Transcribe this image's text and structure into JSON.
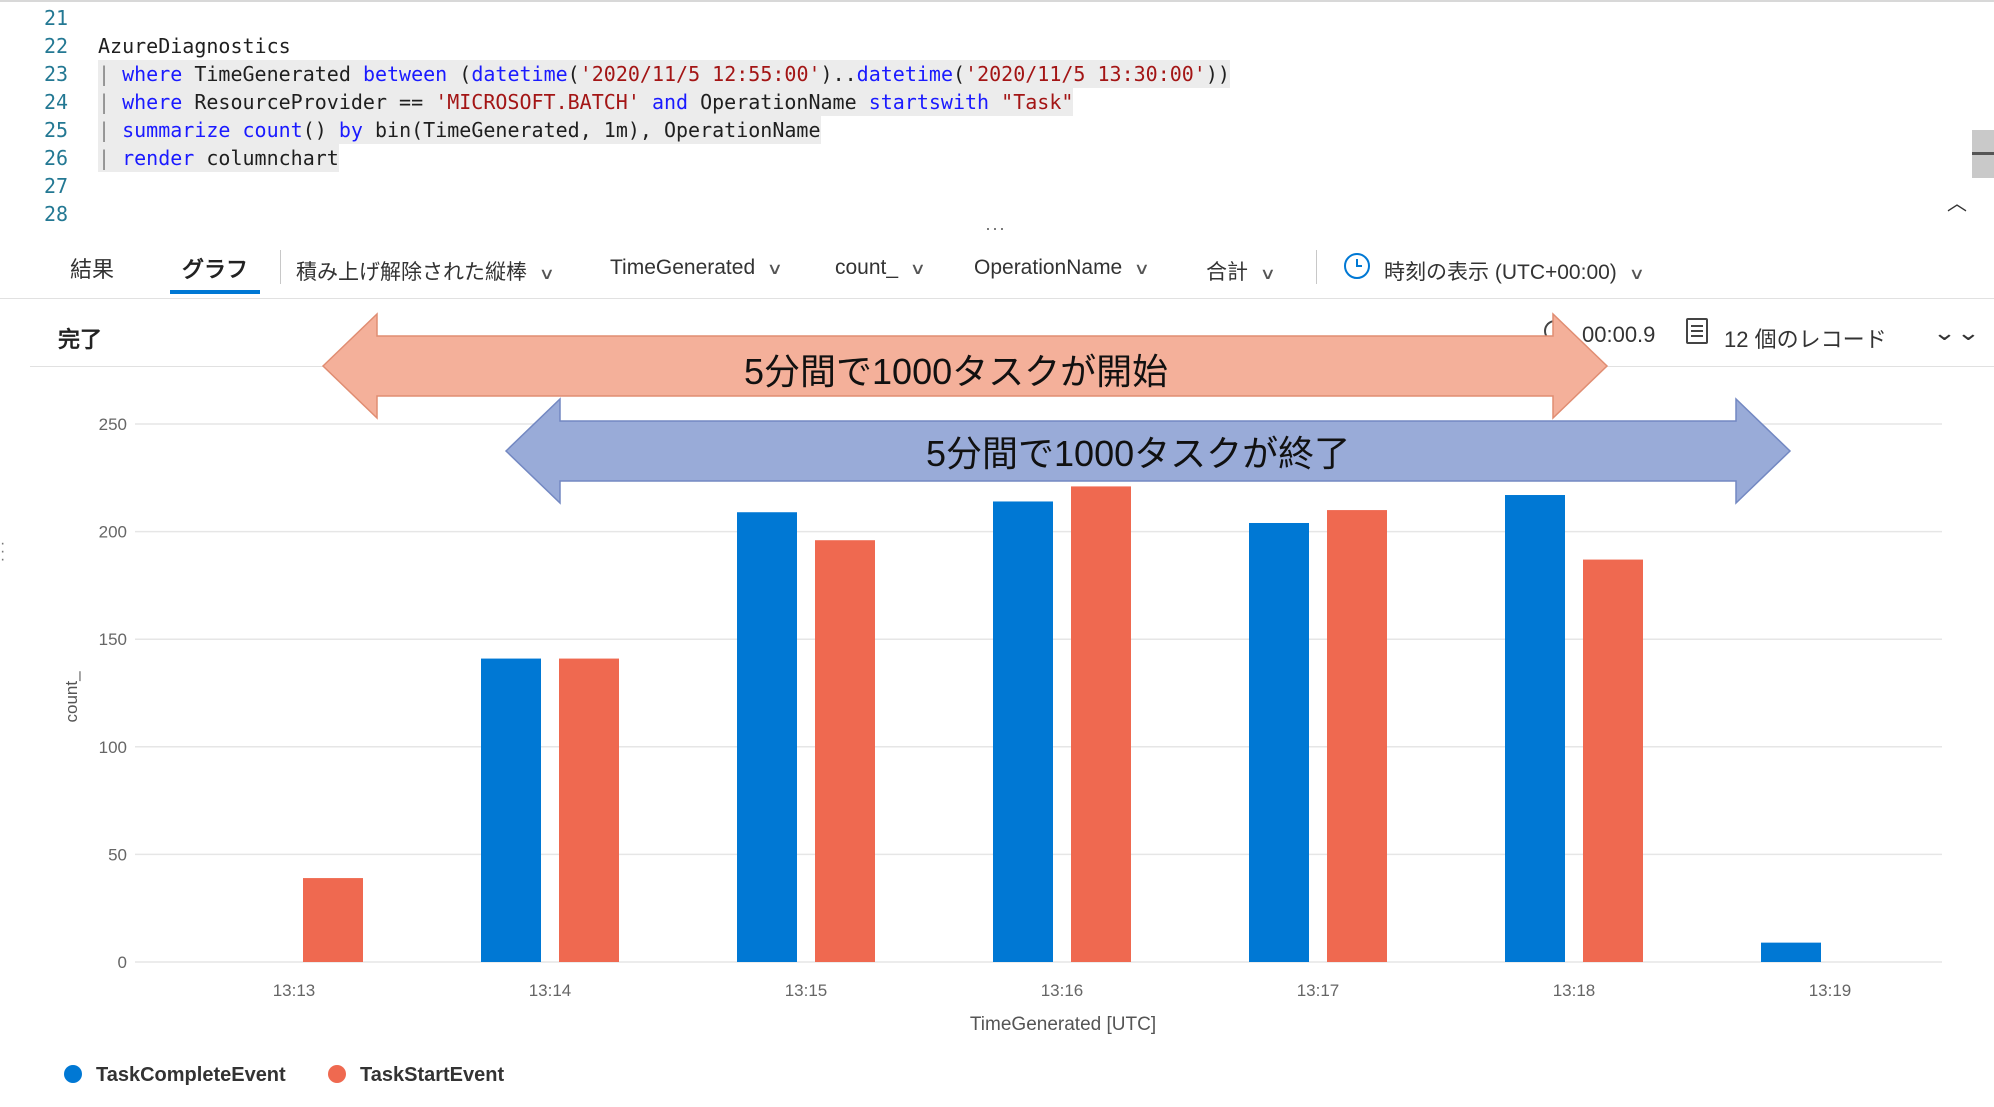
{
  "editor": {
    "lines": [
      {
        "n": "21",
        "text": ""
      },
      {
        "n": "22",
        "text": "AzureDiagnostics"
      },
      {
        "n": "23",
        "text": "| where TimeGenerated between (datetime('2020/11/5 12:55:00')..datetime('2020/11/5 13:30:00'))"
      },
      {
        "n": "24",
        "text": "| where ResourceProvider == 'MICROSOFT.BATCH' and OperationName startswith \"Task\""
      },
      {
        "n": "25",
        "text": "| summarize count() by bin(TimeGenerated, 1m), OperationName"
      },
      {
        "n": "26",
        "text": "| render columnchart"
      },
      {
        "n": "27",
        "text": ""
      },
      {
        "n": "28",
        "text": ""
      }
    ]
  },
  "toolbar": {
    "tab_results": "結果",
    "tab_chart": "グラフ",
    "chart_type": "積み上げ解除された縦棒",
    "x_column": "TimeGenerated",
    "y_column": "count_",
    "split_column": "OperationName",
    "aggregation": "合計",
    "time_display": "時刻の表示 (UTC+00:00)"
  },
  "status": {
    "state": "完了",
    "elapsed": "00:00.9",
    "records": "12 個のレコード"
  },
  "annotations": {
    "start_arrow": "5分間で1000タスクが開始",
    "end_arrow": "5分間で1000タスクが終了",
    "start_color": "#f4b09a",
    "end_color": "#99abd8"
  },
  "chart_data": {
    "type": "bar",
    "categories": [
      "13:13",
      "13:14",
      "13:15",
      "13:16",
      "13:17",
      "13:18",
      "13:19"
    ],
    "series": [
      {
        "name": "TaskCompleteEvent",
        "color": "#0078d4",
        "values": [
          0,
          141,
          209,
          214,
          204,
          217,
          9
        ]
      },
      {
        "name": "TaskStartEvent",
        "color": "#ef6950",
        "values": [
          39,
          141,
          196,
          221,
          210,
          187,
          0
        ]
      }
    ],
    "xlabel": "TimeGenerated [UTC]",
    "ylabel": "count_",
    "ylim": [
      0,
      250
    ],
    "yticks": [
      0,
      50,
      100,
      150,
      200,
      250
    ],
    "grid": true,
    "legend": "bottom-left"
  }
}
